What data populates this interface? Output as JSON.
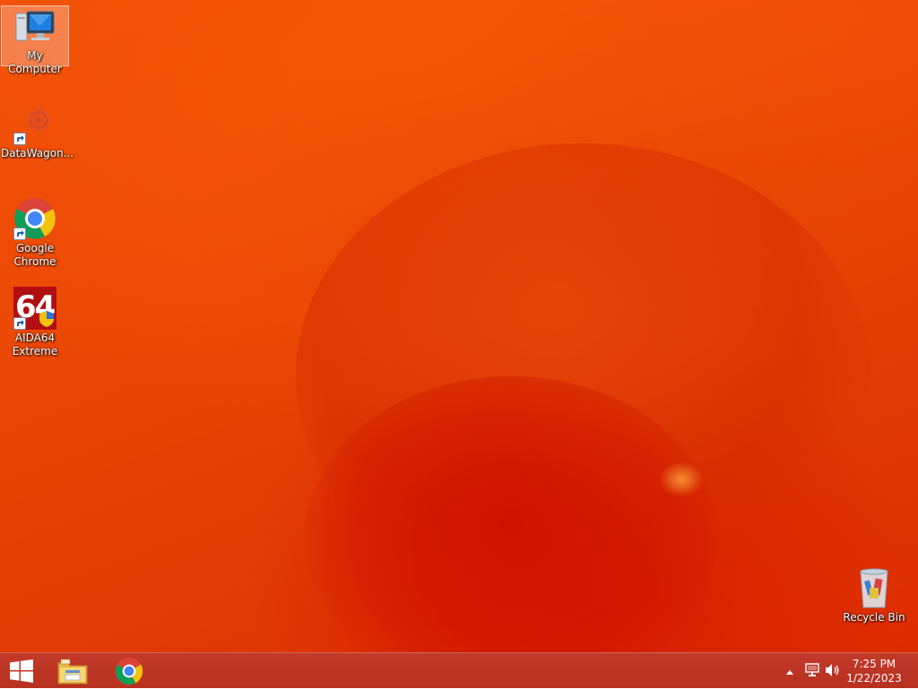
{
  "desktop": {
    "icons": [
      {
        "label": "My Computer",
        "icon": "computer-icon",
        "selected": true
      },
      {
        "label": "DataWagon...",
        "icon": "datawagon-icon"
      },
      {
        "label": "Google Chrome",
        "icon": "chrome-icon"
      },
      {
        "label": "AIDA64 Extreme",
        "icon": "aida64-icon",
        "glyph_text": "64"
      },
      {
        "label": "Recycle Bin",
        "icon": "recycle-bin-icon"
      }
    ]
  },
  "taskbar": {
    "buttons": [
      {
        "icon": "windows-start-icon"
      },
      {
        "icon": "file-explorer-icon"
      },
      {
        "icon": "chrome-icon"
      }
    ],
    "tray": {
      "icons": [
        "show-hidden-icons-chevron",
        "network-icon",
        "volume-icon"
      ],
      "time": "7:25 PM",
      "date": "1/22/2023"
    }
  },
  "colors": {
    "wallpaper": "#ea4605",
    "taskbar": "#bd3424"
  }
}
